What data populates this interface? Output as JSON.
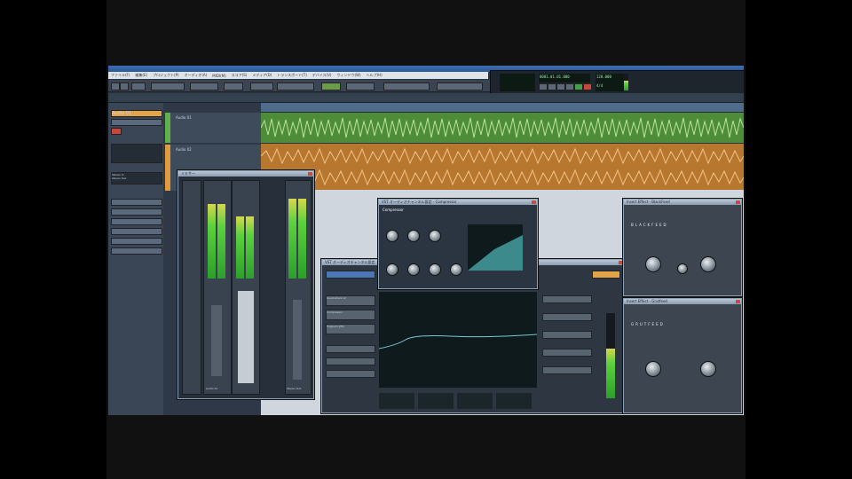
{
  "menu": {
    "items": [
      "ファイル(F)",
      "編集(E)",
      "プロジェクト(P)",
      "オーディオ(A)",
      "MIDI(M)",
      "スコア(S)",
      "メディア(D)",
      "トランスポート(T)",
      "デバイス(V)",
      "ウィンドウ(W)",
      "ヘルプ(H)"
    ]
  },
  "transport": {
    "position": "0001.01.01.000",
    "tempo": "120.000",
    "signature": "4/4"
  },
  "inspector": {
    "track_label": "Audio 01",
    "routing_in": "Stereo In",
    "routing_out": "Stereo Out"
  },
  "tracks": [
    {
      "name": "Audio 01",
      "color": "#4f8c3a"
    },
    {
      "name": "Audio 02",
      "color": "#b8772e"
    }
  ],
  "mixer": {
    "title": "ミキサー",
    "channels": [
      "Audio 01",
      "Stereo Out"
    ]
  },
  "channel_settings": {
    "title": "VST オーディオチャンネル設定",
    "inserts": [
      "Quadrafuzz v2",
      "Compressor",
      "FrequencyEQ"
    ]
  },
  "compressor": {
    "title": "VST オーディオチャンネル設定 - Compressor",
    "brand": "Compressor"
  },
  "plugins": [
    {
      "title": "Insert Effect - BlackFeed",
      "name": "BLACKFEED"
    },
    {
      "title": "Insert Effect - Grutfeed",
      "name": "GRUTFEED"
    }
  ],
  "colors": {
    "accent": "#3d6fb4",
    "audio_green": "#4f8c3a",
    "audio_orange": "#b8772e"
  }
}
